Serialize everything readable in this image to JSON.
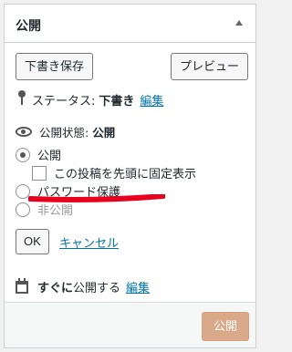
{
  "panel": {
    "title": "公開"
  },
  "actions": {
    "save_label": "下書き保存",
    "preview_label": "プレビュー"
  },
  "status": {
    "label": "ステータス:",
    "value": "下書き",
    "edit_label": "編集"
  },
  "visibility": {
    "label": "公開状態:",
    "value": "公開",
    "options": {
      "public": "公開",
      "sticky": "この投稿を先頭に固定表示",
      "password": "パスワード保護",
      "private": "非公開"
    },
    "ok_label": "OK",
    "cancel_label": "キャンセル"
  },
  "schedule": {
    "bold": "すぐに",
    "text": "公開する",
    "edit_label": "編集"
  },
  "footer": {
    "publish_label": "公開"
  },
  "colors": {
    "link": "#0073aa",
    "publish_button": "#d9a98a",
    "annotation_stroke": "#e8001c"
  }
}
